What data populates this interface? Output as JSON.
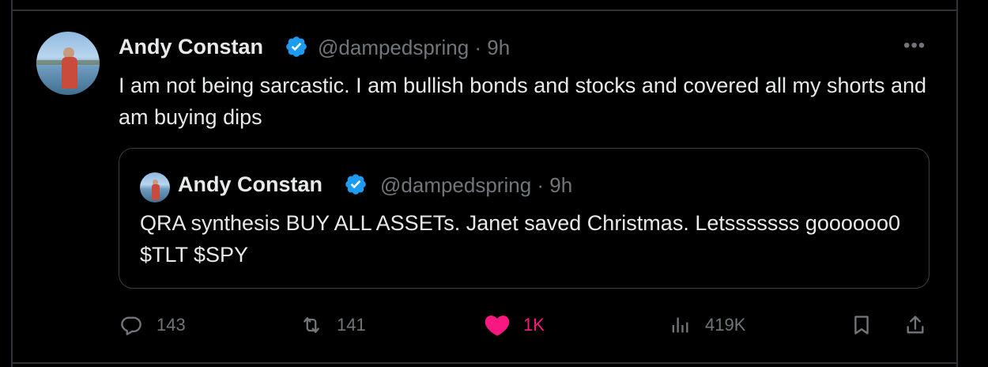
{
  "tweet": {
    "author_name": "Andy Constan",
    "handle": "@dampedspring",
    "time": "· 9h",
    "text": "I am not being sarcastic.  I am bullish bonds and stocks and covered all my shorts and am buying dips",
    "more_label": "•••"
  },
  "quote": {
    "author_name": "Andy Constan",
    "handle": "@dampedspring",
    "time": "· 9h",
    "text": "QRA synthesis BUY ALL ASSETs.  Janet saved Christmas.   Letsssssss goooooo0 $TLT $SPY"
  },
  "actions": {
    "replies": "143",
    "reposts": "141",
    "likes": "1K",
    "views": "419K"
  },
  "colors": {
    "verified": "#1d9bf0",
    "like": "#f91880",
    "muted": "#71767b",
    "text": "#e7e9ea"
  }
}
